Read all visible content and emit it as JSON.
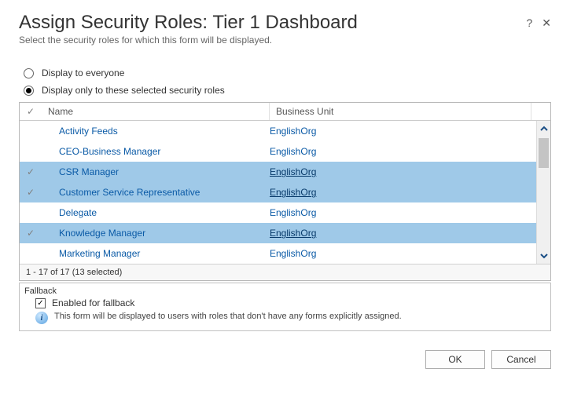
{
  "header": {
    "title": "Assign Security Roles: Tier 1 Dashboard",
    "subtitle": "Select the security roles for which this form will be displayed."
  },
  "options": {
    "everyone_label": "Display to everyone",
    "selected_label": "Display only to these selected security roles",
    "selected_value": "selected"
  },
  "grid": {
    "headers": {
      "name": "Name",
      "business_unit": "Business Unit"
    },
    "rows": [
      {
        "name": "Activity Feeds",
        "bu": "EnglishOrg",
        "selected": false
      },
      {
        "name": "CEO-Business Manager",
        "bu": "EnglishOrg",
        "selected": false
      },
      {
        "name": "CSR Manager",
        "bu": "EnglishOrg",
        "selected": true
      },
      {
        "name": "Customer Service Representative",
        "bu": "EnglishOrg",
        "selected": true
      },
      {
        "name": "Delegate",
        "bu": "EnglishOrg",
        "selected": false
      },
      {
        "name": "Knowledge Manager",
        "bu": "EnglishOrg",
        "selected": true
      },
      {
        "name": "Marketing Manager",
        "bu": "EnglishOrg",
        "selected": false
      }
    ],
    "pager": "1 - 17 of 17 (13 selected)"
  },
  "fallback": {
    "section_label": "Fallback",
    "checkbox_label": "Enabled for fallback",
    "checked": true,
    "info_text": "This form will be displayed to users with roles that don't have any forms explicitly assigned."
  },
  "buttons": {
    "ok": "OK",
    "cancel": "Cancel"
  }
}
